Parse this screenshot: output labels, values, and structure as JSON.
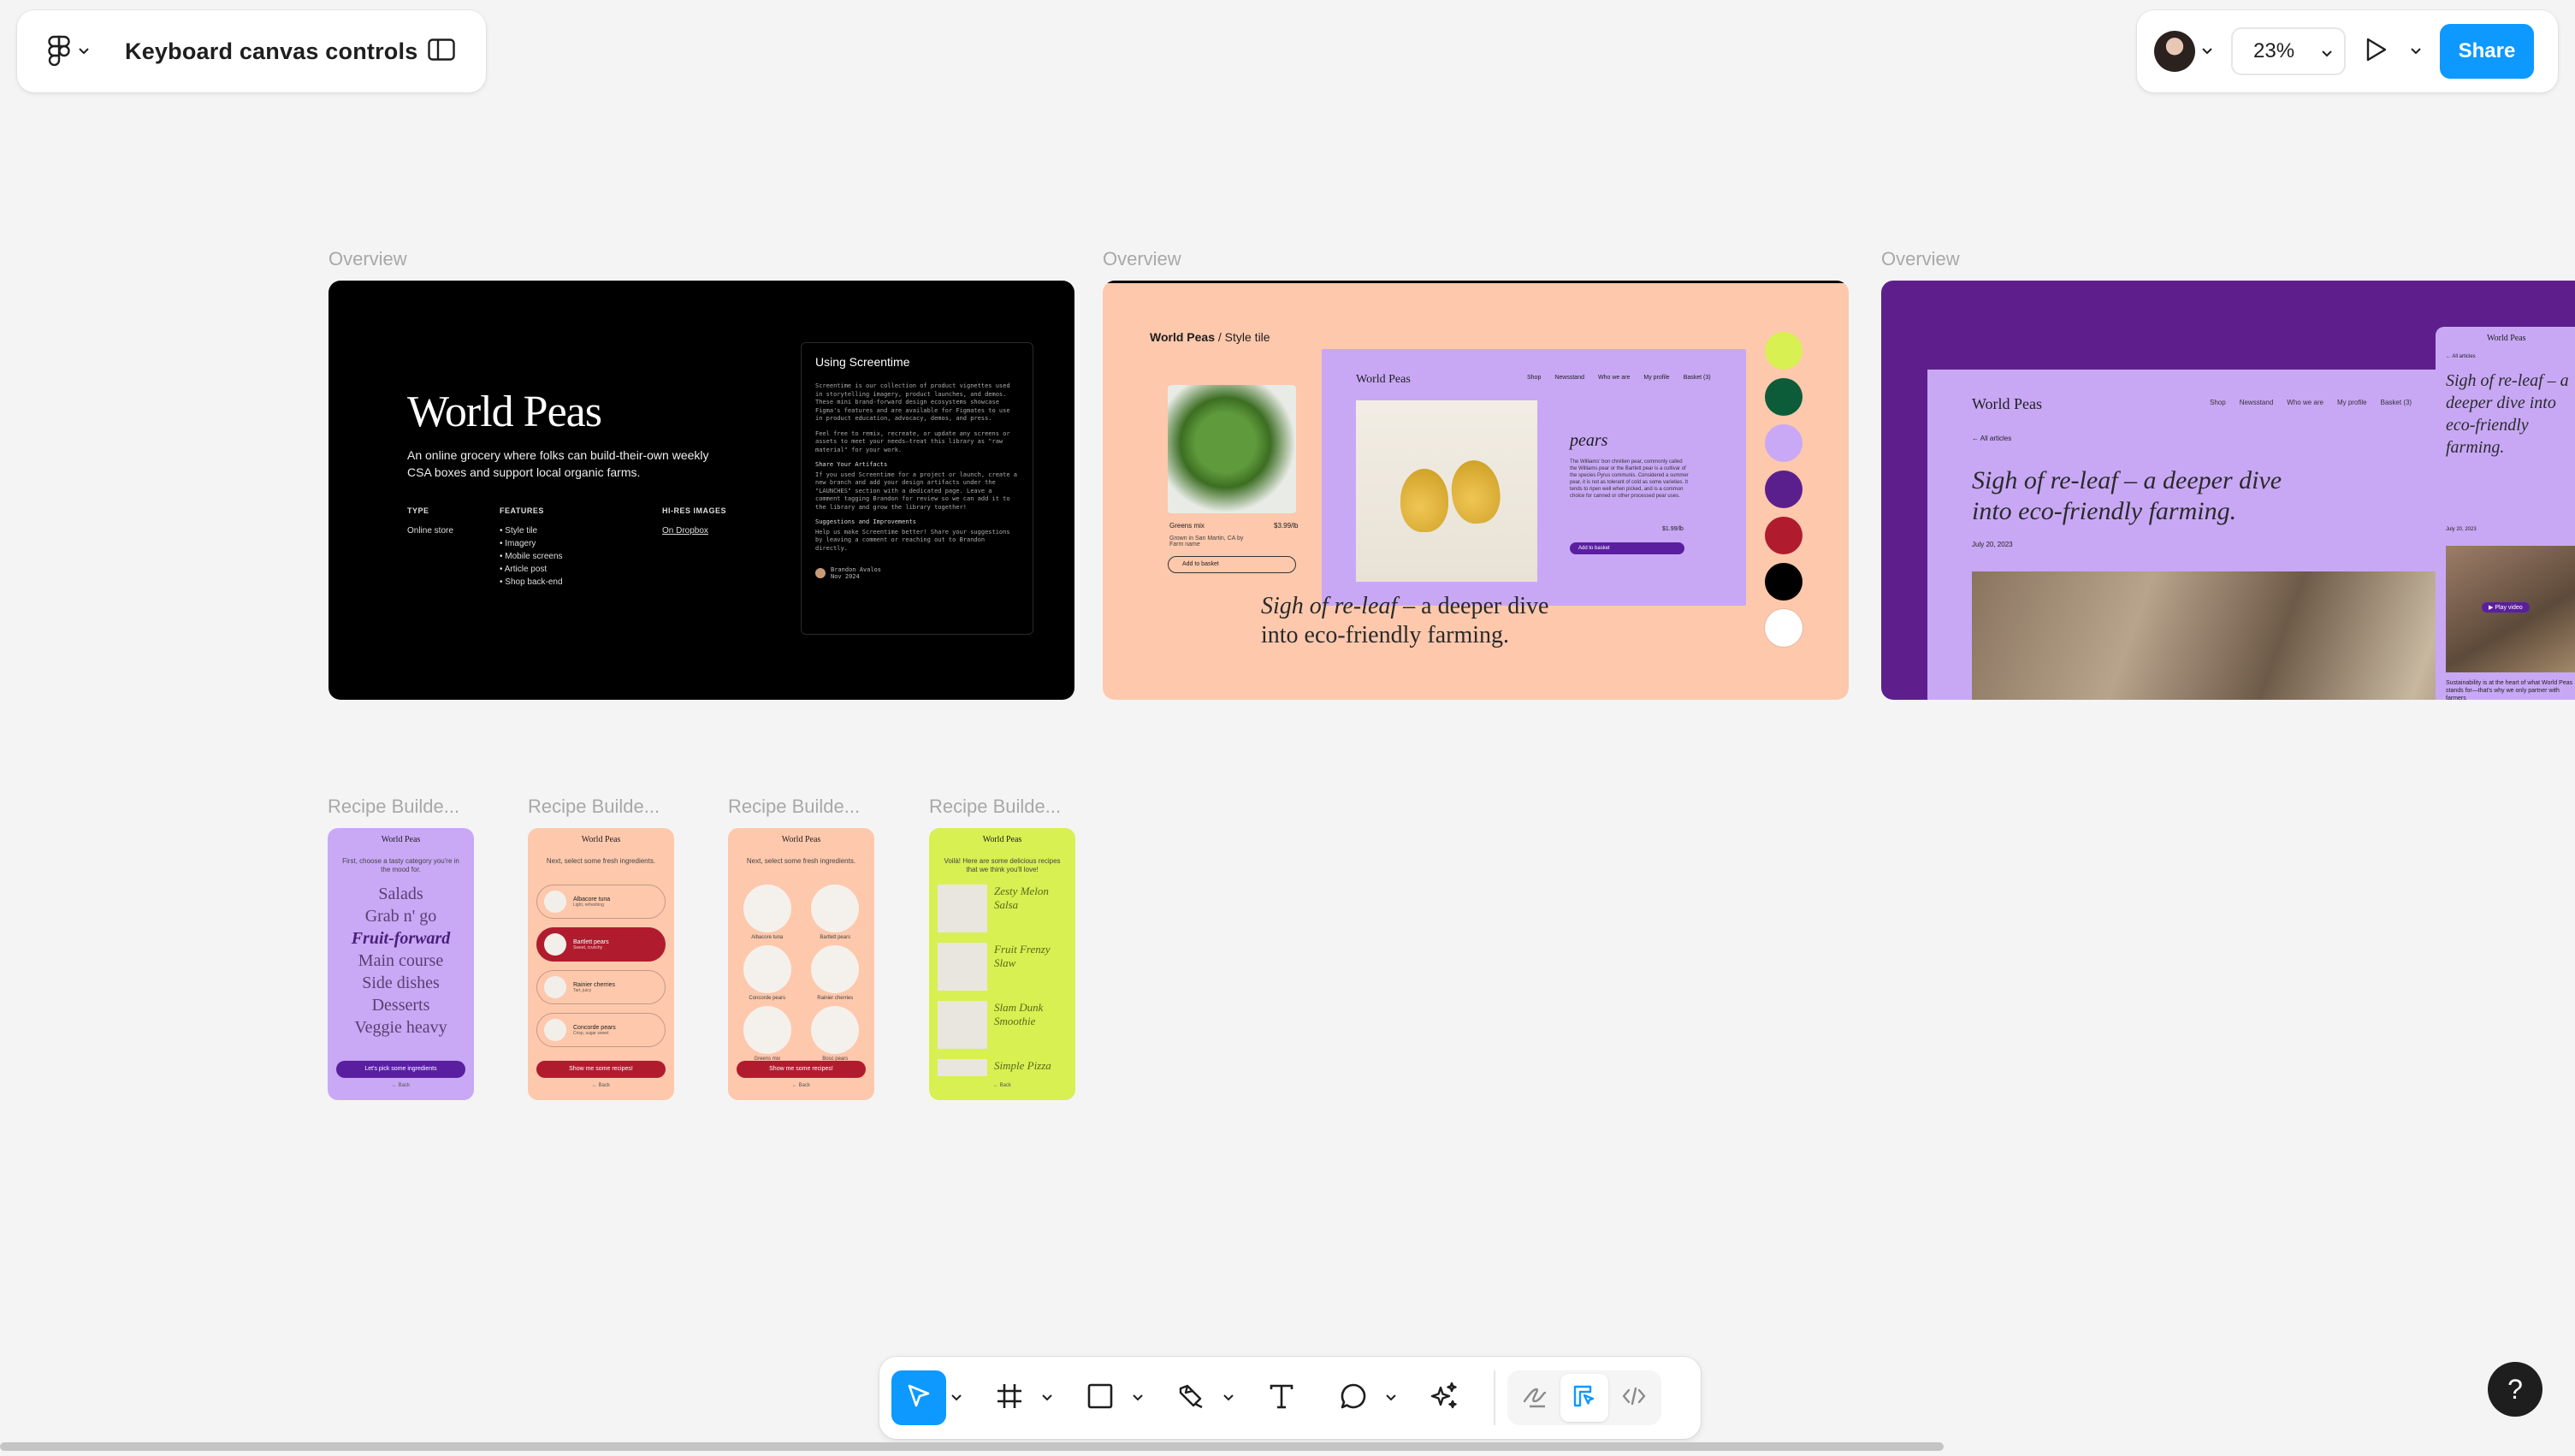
{
  "file": {
    "title": "Keyboard canvas controls",
    "menu_icon": "figma-logo-icon",
    "sidebar_icon": "sidebar-toggle-icon"
  },
  "header": {
    "zoom": "23%",
    "share_label": "Share",
    "help_label": "?"
  },
  "colors": {
    "accent": "#0d99ff",
    "canvas": "#f4f4f4"
  },
  "frames": {
    "overview_label": "Overview",
    "f1": {
      "title": "World Peas",
      "description": "An online grocery where folks can build-their-own weekly CSA boxes and support local organic farms.",
      "type_label": "TYPE",
      "type_value": "Online store",
      "features_label": "FEATURES",
      "features": [
        "Style tile",
        "Imagery",
        "Mobile screens",
        "Article post",
        "Shop back-end"
      ],
      "hires_label": "HI-RES IMAGES",
      "hires_value": "On Dropbox",
      "card_title": "Using Screentime",
      "card_p1": "Screentime is our collection of product vignettes used in storytelling imagery, product launches, and demos. These mini brand-forward design ecosystems showcase Figma's features and are available for Figmates to use in product education, advocacy, demos, and press.",
      "card_p2": "Feel free to remix, recreate, or update any screens or assets to meet your needs—treat this library as \"raw material\" for your work.",
      "card_h2": "Share Your Artifacts",
      "card_p3": "If you used Screentime for a project or launch, create a new branch and add your design artifacts under the \"LAUNCHES\" section with a dedicated page. Leave a comment tagging Brandon for review so we can add it to the library and grow the library together!",
      "card_h3": "Suggestions and Improvements",
      "card_p4": "Help us make Screentime better! Share your suggestions by leaving a comment or reaching out to Brandon directly.",
      "card_author": "Brandon Avalos",
      "card_date": "Nov 2024"
    },
    "f2": {
      "tile_title": "World Peas",
      "tile_sub": " / Style tile",
      "greens_name": "Greens mix",
      "greens_price": "$3.99/lb",
      "greens_sub": "Grown in San Martin, CA by Farm name",
      "add_label": "Add to basket",
      "lav_brand": "World Peas",
      "nav": [
        "Shop",
        "Newsstand",
        "Who we are",
        "My profile",
        "Basket (3)"
      ],
      "pears_title": "pears",
      "pears_text": "The Williams' bon chrétien pear, commonly called the Williams pear or the Bartlett pear is a cultivar of the species Pyrus communis. Considered a summer pear, it is not as tolerant of cold as some varieties. It tends to ripen well when picked, and is a common choice for canned or other processed pear uses.",
      "pears_price": "$1.99/lb",
      "pears_btn": "Add to basket",
      "tagline_italic": "Sigh of re-leaf",
      "tagline_rest": " – a deeper dive into eco-friendly farming.",
      "swatches": [
        "#d8f052",
        "#0c5c3a",
        "#c9a8f6",
        "#5a1f8c",
        "#b01c2e",
        "#000000",
        "#ffffff"
      ]
    },
    "f3": {
      "brand": "World Peas",
      "nav": [
        "Shop",
        "Newsstand",
        "Who we are",
        "My profile",
        "Basket (3)"
      ],
      "back": "← All articles",
      "headline": "Sigh of re-leaf – a deeper dive into eco-friendly farming.",
      "date": "July 20, 2023",
      "mobile_brand": "World Peas",
      "mobile_back": "← All articles",
      "mobile_headline": "Sigh of re-leaf – a deeper dive into eco-friendly farming.",
      "mobile_date": "July 20, 2023",
      "mobile_play": "▶ Play video",
      "mobile_text": "Sustainability is at the heart of what World Peas stands for—that's why we only partner with farmers"
    },
    "recipe_label": "Recipe Builde...",
    "rb1": {
      "brand": "World Peas",
      "intro": "First, choose a tasty category you're in the mood for.",
      "categories": [
        "Salads",
        "Grab n' go",
        "Fruit-forward",
        "Main course",
        "Side dishes",
        "Desserts",
        "Veggie heavy"
      ],
      "cta": "Let's pick some ingredients",
      "back": "← Back"
    },
    "rb2": {
      "brand": "World Peas",
      "intro": "Next, select some fresh ingredients.",
      "items": [
        {
          "name": "Albacore tuna",
          "note": "Light, refreshing"
        },
        {
          "name": "Bartlett pears",
          "note": "Sweet, crunchy"
        },
        {
          "name": "Rainier cherries",
          "note": "Tart, juicy"
        },
        {
          "name": "Concorde pears",
          "note": "Crisp, sugar sweet"
        }
      ],
      "cta": "Show me some recipes!",
      "back": "← Back"
    },
    "rb3": {
      "brand": "World Peas",
      "intro": "Next, select some fresh ingredients.",
      "cells": [
        "Albacore tuna",
        "Bartlett pears",
        "Concorde pears",
        "Rainier cherries",
        "Greens mix",
        "Bosc pears"
      ],
      "cta": "Show me some recipes!",
      "back": "← Back"
    },
    "rb4": {
      "brand": "World Peas",
      "intro": "Voilà! Here are some delicious recipes that we think you'll love!",
      "recipes": [
        "Zesty Melon Salsa",
        "Fruit Frenzy Slaw",
        "Slam Dunk Smoothie",
        "Simple Pizza"
      ],
      "back": "← Back"
    }
  },
  "toolbar": {
    "tools": [
      "move-tool",
      "frame-tool",
      "shape-tool",
      "pen-tool",
      "text-tool",
      "comment-tool",
      "actions-tool"
    ],
    "dev_modes": [
      "draw-mode",
      "design-mode",
      "dev-mode"
    ]
  }
}
